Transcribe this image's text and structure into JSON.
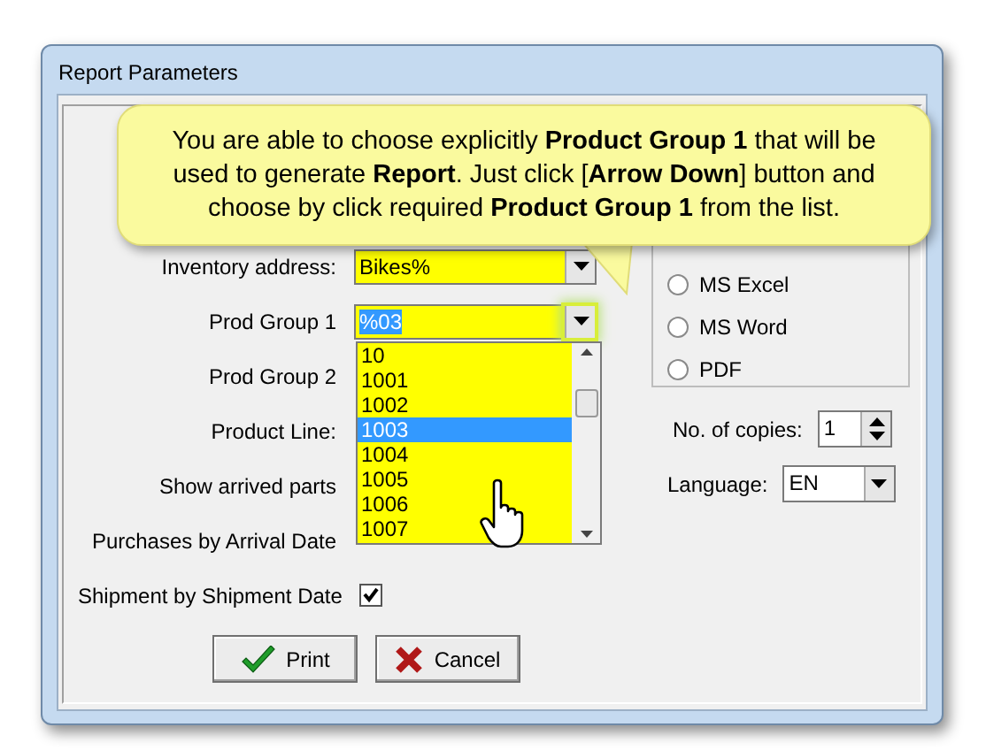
{
  "window": {
    "title": "Report Parameters"
  },
  "callout": {
    "text": "You are able to choose explicitly **Product Group 1** that will be used to generate **Report**.  Just click [**Arrow Down**] button and choose by click required **Product Group 1** from the list."
  },
  "fields": [
    {
      "label": "Inventory address:",
      "kind": "combo",
      "value": "Bikes%",
      "text_selected": false,
      "highlighted": false
    },
    {
      "label": "Prod Group 1",
      "kind": "combo",
      "value": "%03",
      "text_selected": true,
      "highlighted": true
    },
    {
      "label": "Prod Group 2",
      "kind": "label"
    },
    {
      "label": "Product Line:",
      "kind": "label"
    },
    {
      "label": "Show arrived parts",
      "kind": "label"
    },
    {
      "label": "Purchases by Arrival Date",
      "kind": "label"
    },
    {
      "label": "Shipment by Shipment Date",
      "kind": "checkbox",
      "checked": true
    }
  ],
  "dropdown_list": {
    "items": [
      {
        "text": "10",
        "selected": false
      },
      {
        "text": "1001",
        "selected": false
      },
      {
        "text": "1002",
        "selected": false
      },
      {
        "text": "1003",
        "selected": true
      },
      {
        "text": "1004",
        "selected": false
      },
      {
        "text": "1005",
        "selected": false
      },
      {
        "text": "1006",
        "selected": false
      },
      {
        "text": "1007",
        "selected": false
      }
    ]
  },
  "output_options": [
    {
      "label": "MS Excel",
      "selected": false
    },
    {
      "label": "MS Word",
      "selected": false
    },
    {
      "label": "PDF",
      "selected": false
    }
  ],
  "copies": {
    "label": "No. of copies:",
    "value": "1"
  },
  "language": {
    "label": "Language:",
    "value": "EN"
  },
  "buttons": [
    {
      "label": "Print",
      "kind": "ok"
    },
    {
      "label": "Cancel",
      "kind": "cancel"
    }
  ]
}
